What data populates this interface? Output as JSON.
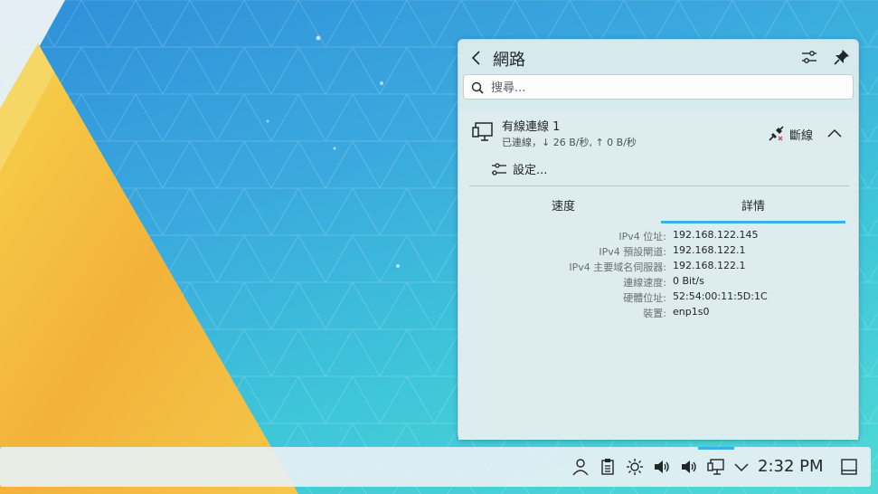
{
  "popup": {
    "title": "網路",
    "search_placeholder": "搜尋...",
    "connection": {
      "name": "有線連線 1",
      "status": "已連線，↓ 26 B/秒, ↑ 0 B/秒",
      "disconnect_label": "斷線"
    },
    "settings_label": "設定...",
    "tabs": [
      {
        "label": "速度"
      },
      {
        "label": "詳情"
      }
    ],
    "active_tab": "詳情",
    "details": [
      {
        "label": "IPv4 位址:",
        "value": "192.168.122.145"
      },
      {
        "label": "IPv4 預設閘道:",
        "value": "192.168.122.1"
      },
      {
        "label": "IPv4 主要域名伺服器:",
        "value": "192.168.122.1"
      },
      {
        "label": "連線速度:",
        "value": "0 Bit/s"
      },
      {
        "label": "硬體位址:",
        "value": "52:54:00:11:5D:1C"
      },
      {
        "label": "裝置:",
        "value": "enp1s0"
      }
    ]
  },
  "taskbar": {
    "clock": "2:32 PM",
    "tray_icons": [
      "user-icon",
      "clipboard-icon",
      "brightness-icon",
      "volume-icon",
      "audio-icon",
      "network-icon",
      "expand-icon",
      "show-desktop-icon"
    ]
  },
  "colors": {
    "accent": "#3daee9",
    "popup_bg": "#d6e9ec",
    "wallpaper_yellow": "#f2b63c"
  }
}
